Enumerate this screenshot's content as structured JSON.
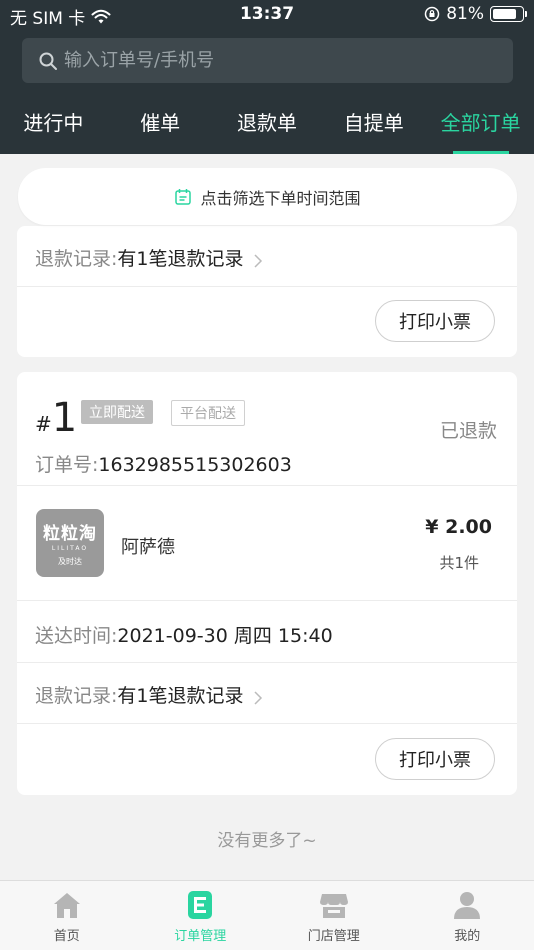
{
  "status_bar": {
    "carrier": "无 SIM 卡",
    "time": "13:37",
    "battery": "81%",
    "battery_level": 0.81
  },
  "search": {
    "placeholder": "输入订单号/手机号"
  },
  "tabs": [
    {
      "label": "进行中",
      "active": false
    },
    {
      "label": "催单",
      "active": false
    },
    {
      "label": "退款单",
      "active": false
    },
    {
      "label": "自提单",
      "active": false
    },
    {
      "label": "全部订单",
      "active": true
    }
  ],
  "filter": {
    "label": "点击筛选下单时间范围"
  },
  "card1": {
    "refund_label": "退款记录:",
    "refund_value": "有1笔退款记录",
    "print_label": "打印小票"
  },
  "card2": {
    "hash": "#",
    "number": "1",
    "tag_delivery": "立即配送",
    "tag_platform": "平台配送",
    "status": "已退款",
    "order_label": "订单号:",
    "order_no": "1632985515302603",
    "store_logo_text": "粒粒淘",
    "store_logo_latin": "LILITAO",
    "store_logo_sub": "及时达",
    "customer": "阿萨德",
    "price": "¥ 2.00",
    "count": "共1件",
    "delivery_label": "送达时间:",
    "delivery_time": "2021-09-30 周四 15:40",
    "refund_label": "退款记录:",
    "refund_value": "有1笔退款记录",
    "print_label": "打印小票"
  },
  "no_more": "没有更多了~",
  "bottom_nav": [
    {
      "label": "首页",
      "icon": "home-icon",
      "active": false
    },
    {
      "label": "订单管理",
      "icon": "order-icon",
      "active": true
    },
    {
      "label": "门店管理",
      "icon": "store-icon",
      "active": false
    },
    {
      "label": "我的",
      "icon": "user-icon",
      "active": false
    }
  ],
  "colors": {
    "header": "#2a3439",
    "accent": "#2ad5a0",
    "background": "#f2f2f2"
  }
}
